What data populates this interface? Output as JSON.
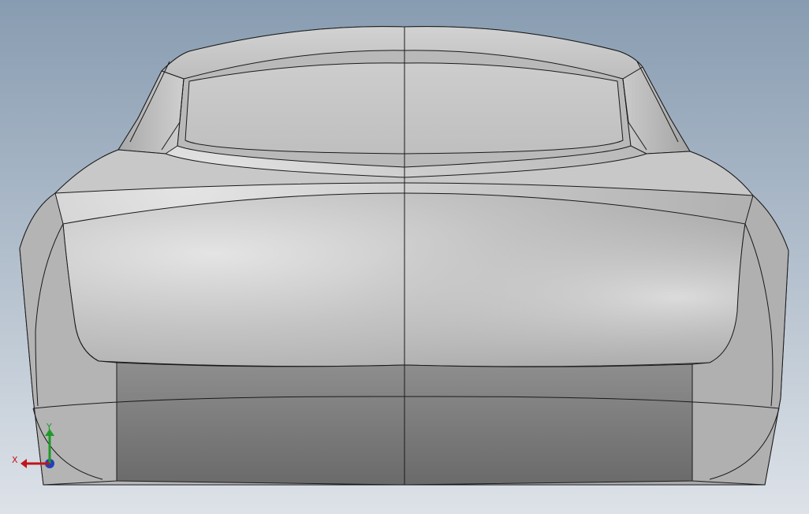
{
  "viewport": {
    "background_top": "#8b9fb4",
    "background_bottom": "#d9dfe6",
    "model_base": "#c6c6c6",
    "edge_color": "#1a1a1a",
    "triad": {
      "x_label": "X",
      "y_label": "Y",
      "x_color": "#c0151a",
      "y_color": "#1e9a27",
      "z_color": "#2140b8"
    }
  }
}
